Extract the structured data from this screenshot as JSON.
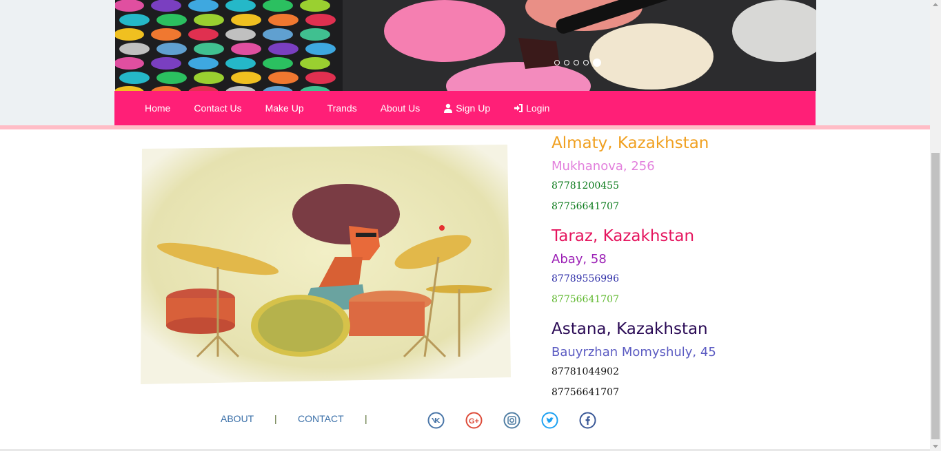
{
  "slider": {
    "dots": [
      {
        "active": false
      },
      {
        "active": false
      },
      {
        "active": false
      },
      {
        "active": false
      },
      {
        "active": true
      }
    ]
  },
  "nav": {
    "items": [
      {
        "label": "Home"
      },
      {
        "label": "Contact Us"
      },
      {
        "label": "Make Up"
      },
      {
        "label": "Trands"
      },
      {
        "label": "About Us"
      },
      {
        "label": "Sign Up",
        "icon": "user-icon"
      },
      {
        "label": "Login",
        "icon": "login-icon"
      }
    ],
    "color": "#ff1f77"
  },
  "contacts": [
    {
      "city": "Almaty, Kazakhstan",
      "street": "Mukhanova, 256",
      "phones": [
        "87781200455",
        "87756641707"
      ],
      "colors": {
        "city": "#f0a020",
        "street": "#e27fdc",
        "phone1": "#0a7a1a",
        "phone2": "#0a7a1a"
      }
    },
    {
      "city": "Taraz, Kazakhstan",
      "street": "Abay, 58",
      "phones": [
        "87789556996",
        "87756641707"
      ],
      "colors": {
        "city": "#e5155e",
        "street": "#9b1fb5",
        "phone1": "#2f2fa8",
        "phone2": "#5fb82e"
      }
    },
    {
      "city": "Astana, Kazakhstan",
      "street": "Bauyrzhan Momyshuly, 45",
      "phones": [
        "87781044902",
        "87756641707"
      ],
      "colors": {
        "city": "#2a0a55",
        "street": "#5b5bc2",
        "phone1": "#111111",
        "phone2": "#111111"
      }
    }
  ],
  "footer": {
    "about": "ABOUT",
    "contact": "CONTACT",
    "separator": "|",
    "social": [
      {
        "icon": "vk-icon",
        "color": "#4a76a8"
      },
      {
        "icon": "google-plus-icon",
        "color": "#dd4b39"
      },
      {
        "icon": "instagram-icon",
        "color": "#517fa4"
      },
      {
        "icon": "twitter-icon",
        "color": "#1da1f2"
      },
      {
        "icon": "facebook-icon",
        "color": "#3b5998"
      }
    ]
  }
}
